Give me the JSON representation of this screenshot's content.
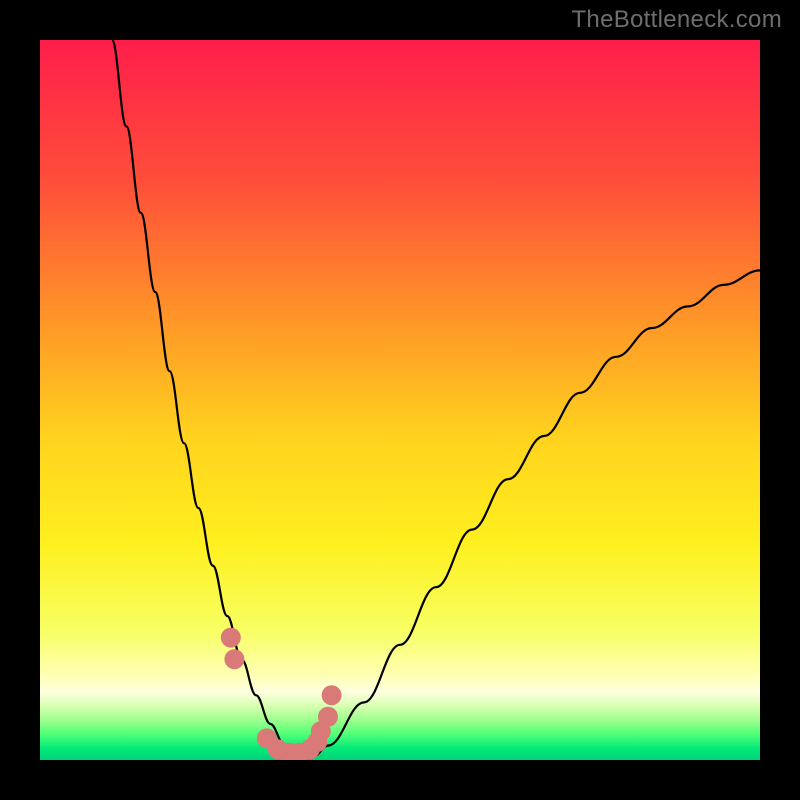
{
  "watermark": "TheBottleneck.com",
  "chart_data": {
    "type": "line",
    "title": "",
    "xlabel": "",
    "ylabel": "",
    "xlim": [
      0,
      100
    ],
    "ylim": [
      0,
      100
    ],
    "series": [
      {
        "name": "bottleneck-curve",
        "x": [
          10,
          12,
          14,
          16,
          18,
          20,
          22,
          24,
          26,
          28,
          30,
          32,
          34,
          36,
          38,
          40,
          45,
          50,
          55,
          60,
          65,
          70,
          75,
          80,
          85,
          90,
          95,
          100
        ],
        "y": [
          100,
          88,
          76,
          65,
          54,
          44,
          35,
          27,
          20,
          14,
          9,
          5,
          2,
          0.5,
          0.5,
          2,
          8,
          16,
          24,
          32,
          39,
          45,
          51,
          56,
          60,
          63,
          66,
          68
        ]
      },
      {
        "name": "highlight-dots",
        "x": [
          26.5,
          27,
          31.5,
          33,
          34.5,
          36,
          37.5,
          38.5,
          39,
          40,
          40.5
        ],
        "y": [
          17,
          14,
          3,
          1.5,
          1,
          1,
          1.5,
          2.5,
          4,
          6,
          9
        ]
      }
    ],
    "background_gradient": {
      "stops": [
        {
          "pos": 0.0,
          "color": "#ff1e4b"
        },
        {
          "pos": 0.2,
          "color": "#ff4f39"
        },
        {
          "pos": 0.4,
          "color": "#ff9a27"
        },
        {
          "pos": 0.55,
          "color": "#ffd21e"
        },
        {
          "pos": 0.7,
          "color": "#fff01f"
        },
        {
          "pos": 0.82,
          "color": "#f7ff62"
        },
        {
          "pos": 0.88,
          "color": "#ffffb0"
        },
        {
          "pos": 0.905,
          "color": "#ffffe0"
        },
        {
          "pos": 0.925,
          "color": "#d7ffb0"
        },
        {
          "pos": 0.945,
          "color": "#9bff8c"
        },
        {
          "pos": 0.965,
          "color": "#4dff78"
        },
        {
          "pos": 0.985,
          "color": "#00e878"
        },
        {
          "pos": 1.0,
          "color": "#00d27a"
        }
      ]
    },
    "curve_color": "#000000",
    "dot_color": "#d97a78",
    "dot_radius": 10
  }
}
